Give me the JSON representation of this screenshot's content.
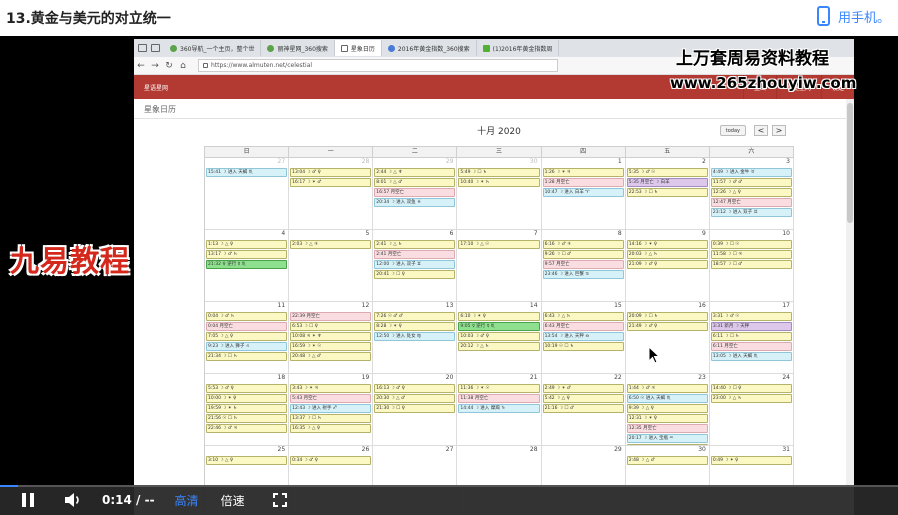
{
  "header": {
    "title": "13.黄金与美元的对立统一",
    "mobile_link": "用手机。"
  },
  "browser": {
    "tabs": [
      {
        "label": "360导航_一个主页，整个世",
        "fav": "",
        "active": false
      },
      {
        "label": "丽神星网_360搜索",
        "fav": "",
        "active": false
      },
      {
        "label": "星象日历",
        "fav": "doc",
        "active": true
      },
      {
        "label": "2016年黄金指数_360搜索",
        "fav": "blue",
        "active": false
      },
      {
        "label": "(1)2016年黄金指数周",
        "fav": "green",
        "active": false
      }
    ],
    "url": "https://www.almuten.net/celestial"
  },
  "site": {
    "nav_left": "星语星网",
    "nav_right": [
      "登出",
      "快捷星网",
      "设定"
    ],
    "page_heading": "星象日历"
  },
  "calendar": {
    "month": "十月 2020",
    "today_label": "today",
    "prev_label": "<",
    "next_label": ">",
    "weekdays": [
      "日",
      "一",
      "二",
      "三",
      "四",
      "五",
      "六"
    ],
    "weeks": [
      [
        {
          "d": "27",
          "o": true,
          "ev": [
            [
              "15:41 ☽ 进入 天蝎 ♏",
              "b"
            ]
          ]
        },
        {
          "d": "28",
          "o": true,
          "ev": [
            [
              "13:04 ☽ ♂ ♀",
              "y"
            ],
            [
              "16:17 ☽ ✶ ♂",
              "y"
            ]
          ]
        },
        {
          "d": "29",
          "o": true,
          "ev": [
            [
              "2:44 ☽ △ ♆",
              "y"
            ],
            [
              "8:01 ☽ △ ♂",
              "y"
            ],
            [
              "16:57 月空亡",
              "p"
            ],
            [
              "20:34 ☽ 进入 双鱼 ♓",
              "b"
            ]
          ]
        },
        {
          "d": "30",
          "o": true,
          "ev": [
            [
              "5:49 ☽ ☐ ♄",
              "y"
            ],
            [
              "10:40 ☽ ✶ ♄",
              "y"
            ]
          ]
        },
        {
          "d": "1",
          "o": false,
          "ev": [
            [
              "1:26 ☽ ✶ ♃",
              "y"
            ],
            [
              "1:28 月空亡",
              "p"
            ],
            [
              "10:47 ☽ 进入 白羊 ♈",
              "b"
            ]
          ]
        },
        {
          "d": "2",
          "o": false,
          "ev": [
            [
              "5:35 ☽ ♂ ☉",
              "y"
            ],
            [
              "5:35 月空亡 ☽ 白羊",
              "pu"
            ],
            [
              "22:53 ☽ ☐ ♄",
              "y"
            ]
          ]
        },
        {
          "d": "3",
          "o": false,
          "ev": [
            [
              "4:49 ☽ 进入 金牛 ♉",
              "b"
            ],
            [
              "11:57 ☽ ♂ ♂",
              "y"
            ],
            [
              "12:26 ☽ △ ♀",
              "y"
            ],
            [
              "12:47 月空亡",
              "p"
            ],
            [
              "23:12 ☽ 进入 双子 ♊",
              "b"
            ]
          ]
        }
      ],
      [
        {
          "d": "4",
          "o": false,
          "ev": [
            [
              "1:13 ☽ △ ♀",
              "y"
            ],
            [
              "13:17 ☽ ♂ ♄",
              "y"
            ],
            [
              "21:32 ♀ 逆行 ☿ ♏",
              "g"
            ]
          ]
        },
        {
          "d": "5",
          "o": false,
          "ev": [
            [
              "2:03 ☽ △ ♃",
              "y"
            ]
          ]
        },
        {
          "d": "6",
          "o": false,
          "ev": [
            [
              "2:41 ☽ △ ♄",
              "y"
            ],
            [
              "2:41 月空亡",
              "p"
            ],
            [
              "12:00 ☽ 进入 双子 ♊",
              "b"
            ],
            [
              "20:41 ☽ ☐ ♀",
              "y"
            ]
          ]
        },
        {
          "d": "7",
          "o": false,
          "ev": [
            [
              "17:10 ☽ △ ☉",
              "y"
            ]
          ]
        },
        {
          "d": "8",
          "o": false,
          "ev": [
            [
              "6:16 ☽ ♂ ♃",
              "y"
            ],
            [
              "9:26 ☽ ☐ ♂",
              "y"
            ],
            [
              "9:57 月空亡",
              "p"
            ],
            [
              "23:46 ☽ 进入 巨蟹 ♋",
              "b"
            ]
          ]
        },
        {
          "d": "9",
          "o": false,
          "ev": [
            [
              "14:16 ☽ ✶ ♀",
              "y"
            ],
            [
              "20:03 ☽ △ ♄",
              "y"
            ],
            [
              "21:09 ☽ ♂ ♀",
              "y"
            ]
          ]
        },
        {
          "d": "10",
          "o": false,
          "ev": [
            [
              "0:39 ☽ ☐ ☉",
              "y"
            ],
            [
              "11:58 ☽ ☐ ♃",
              "y"
            ],
            [
              "18:57 ☽ ☐ ♂",
              "y"
            ]
          ]
        }
      ],
      [
        {
          "d": "11",
          "o": false,
          "ev": [
            [
              "0:04 ☽ ♂ ♄",
              "y"
            ],
            [
              "0:04 月空亡",
              "p"
            ],
            [
              "7:05 ☽ △ ♀",
              "y"
            ],
            [
              "9:23 ☽ 进入 狮子 ♌",
              "b"
            ],
            [
              "21:34 ☽ ☐ ♄",
              "y"
            ]
          ]
        },
        {
          "d": "12",
          "o": false,
          "ev": [
            [
              "22:39 月空亡",
              "p"
            ],
            [
              "6:53 ☽ ☐ ♀",
              "y"
            ],
            [
              "10:08 ♃ ✶ ♆",
              "y"
            ],
            [
              "16:59 ☽ ✶ ☉",
              "y"
            ],
            [
              "20:48 ☽ △ ♂",
              "y"
            ]
          ]
        },
        {
          "d": "13",
          "o": false,
          "ev": [
            [
              "7:26 ☉ ♂ ♂",
              "y"
            ],
            [
              "8:28 ☽ ✶ ♀",
              "y"
            ],
            [
              "12:50 ☽ 进入 处女 ♍",
              "b"
            ]
          ]
        },
        {
          "d": "14",
          "o": false,
          "ev": [
            [
              "6:10 ☽ ✶ ♀",
              "y"
            ],
            [
              "9:05 ☿ 逆行 ☿ ♏",
              "g"
            ],
            [
              "10:03 ☽ ♂ ♀",
              "y"
            ],
            [
              "20:12 ☽ △ ♄",
              "y"
            ]
          ]
        },
        {
          "d": "15",
          "o": false,
          "ev": [
            [
              "6:43 ☽ △ ♄",
              "y"
            ],
            [
              "6:43 月空亡",
              "p"
            ],
            [
              "13:54 ☽ 进入 天秤 ♎",
              "b"
            ],
            [
              "10:19 ☉ ☐ ♄",
              "y"
            ]
          ]
        },
        {
          "d": "16",
          "o": false,
          "ev": [
            [
              "20:09 ☽ ☐ ♄",
              "y"
            ],
            [
              "21:49 ☽ ♂ ♀",
              "y"
            ]
          ]
        },
        {
          "d": "17",
          "o": false,
          "ev": [
            [
              "3:31 ☽ ♂ ☉",
              "y"
            ],
            [
              "3:31 新月 ☽ 天秤",
              "pu"
            ],
            [
              "6:11 ☽ ☐ ♄",
              "y"
            ],
            [
              "6:11 月空亡",
              "p"
            ],
            [
              "13:05 ☽ 进入 天蝎 ♏",
              "b"
            ]
          ]
        }
      ],
      [
        {
          "d": "18",
          "o": false,
          "ev": [
            [
              "5:53 ☽ ♂ ♀",
              "y"
            ],
            [
              "10:00 ☽ ✶ ♀",
              "y"
            ],
            [
              "19:59 ☽ ✶ ♄",
              "y"
            ],
            [
              "21:56 ☉ ☐ ♄",
              "y"
            ],
            [
              "22:46 ☽ ♂ ♃",
              "y"
            ]
          ]
        },
        {
          "d": "19",
          "o": false,
          "ev": [
            [
              "3:43 ☽ ✶ ♃",
              "y"
            ],
            [
              "5:43 月空亡",
              "p"
            ],
            [
              "12:43 ☽ 进入 射手 ♐",
              "b"
            ],
            [
              "13:37 ☽ ☐ ♄",
              "y"
            ],
            [
              "16:35 ☽ △ ♀",
              "y"
            ]
          ]
        },
        {
          "d": "20",
          "o": false,
          "ev": [
            [
              "16:13 ☽ ♂ ♀",
              "y"
            ],
            [
              "20:30 ☽ △ ♂",
              "y"
            ],
            [
              "21:30 ☽ ☐ ♀",
              "y"
            ]
          ]
        },
        {
          "d": "21",
          "o": false,
          "ev": [
            [
              "11:36 ☽ ✶ ☉",
              "y"
            ],
            [
              "11:38 月空亡",
              "p"
            ],
            [
              "14:44 ☽ 进入 摩羯 ♑",
              "b"
            ]
          ]
        },
        {
          "d": "22",
          "o": false,
          "ev": [
            [
              "2:49 ☽ ✶ ♂",
              "y"
            ],
            [
              "5:42 ☽ △ ♀",
              "y"
            ],
            [
              "21:16 ☽ ☐ ♂",
              "y"
            ]
          ]
        },
        {
          "d": "23",
          "o": false,
          "ev": [
            [
              "1:44 ☽ ♂ ♃",
              "y"
            ],
            [
              "6:50 ☉ 进入 天蝎 ♏",
              "b"
            ],
            [
              "9:39 ☽ △ ♀",
              "y"
            ],
            [
              "12:31 ☽ ✶ ♀",
              "y"
            ],
            [
              "12:35 月空亡",
              "p"
            ],
            [
              "20:17 ☽ 进入 宝瓶 ♒",
              "b"
            ],
            [
              "21:23 ☽ ☐ ☉",
              "y"
            ]
          ]
        },
        {
          "d": "24",
          "o": false,
          "ev": [
            [
              "14:40 ☽ ☐ ♀",
              "y"
            ],
            [
              "23:00 ☽ △ ♄",
              "y"
            ]
          ]
        }
      ],
      [
        {
          "d": "25",
          "o": false,
          "ev": [
            [
              "3:10 ☽ △ ♀",
              "y"
            ]
          ]
        },
        {
          "d": "26",
          "o": false,
          "ev": [
            [
              "0:34 ☽ ♂ ♀",
              "y"
            ]
          ]
        },
        {
          "d": "27",
          "o": false,
          "ev": []
        },
        {
          "d": "28",
          "o": false,
          "ev": []
        },
        {
          "d": "29",
          "o": false,
          "ev": []
        },
        {
          "d": "30",
          "o": false,
          "ev": [
            [
              "2:48 ☽ △ ♂",
              "y"
            ]
          ]
        },
        {
          "d": "31",
          "o": false,
          "ev": [
            [
              "0:49 ☽ ✶ ♀",
              "y"
            ]
          ]
        }
      ]
    ]
  },
  "overlay": {
    "watermark_line1": "上万套周易资料教程",
    "watermark_line2": "www.265zhouyiw.com",
    "brand_text": "九易教程"
  },
  "player": {
    "time": "0:14 / --",
    "quality": "高清",
    "speed": "倍速",
    "progress_fraction": 0.02
  },
  "colors": {
    "nav_red": "#b23a33",
    "event_yellow": "#fbf8c4",
    "event_blue": "#d6f1f8",
    "event_pink": "#f9dde0",
    "event_green": "#8ee08e",
    "event_purple": "#ddc8ec",
    "player_accent": "#3a86ff"
  }
}
